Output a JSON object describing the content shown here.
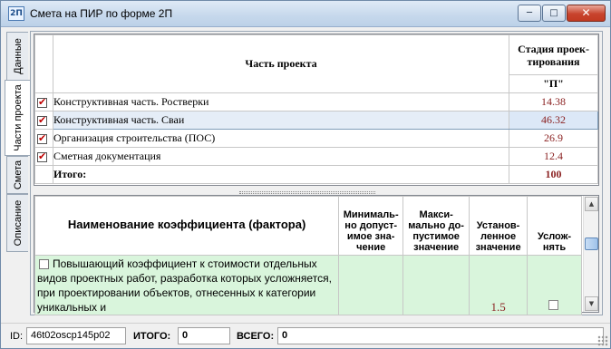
{
  "window": {
    "title": "Смета на ПИР по форме 2П",
    "app_icon_text": "2П",
    "buttons": {
      "minimize": "minimize-icon",
      "maximize": "maximize-icon",
      "close": "close-icon"
    }
  },
  "tabs": [
    {
      "label": "Данные",
      "active": false
    },
    {
      "label": "Части проекта",
      "active": true
    },
    {
      "label": "Смета",
      "active": false
    },
    {
      "label": "Описание",
      "active": false
    }
  ],
  "upper_table": {
    "col_part": "Часть проекта",
    "col_stage": "Стадия проек-тирования",
    "stage_value": "\"П\"",
    "rows": [
      {
        "label": "Конструктивная часть. Ростверки",
        "checked": true,
        "value": "14.38"
      },
      {
        "label": "Конструктивная часть. Сваи",
        "checked": true,
        "value": "46.32",
        "selected": true
      },
      {
        "label": "Организация строительства (ПОС)",
        "checked": true,
        "value": "26.9"
      },
      {
        "label": "Сметная документация",
        "checked": true,
        "value": "12.4"
      }
    ],
    "total_label": "Итого:",
    "total_value": "100"
  },
  "lower_table": {
    "headers": {
      "name": "Наименование коэффициента (фактора)",
      "min": "Минималь-но допуст-имое зна-чение",
      "max": "Макси-мально до-пустимое значение",
      "set": "Установ-ленное значение",
      "complicate": "Услож-нять"
    },
    "rows": [
      {
        "description": "Повышающий коэффициент к стоимости отдельных видов проектных работ, разработка которых усложняется, при проектировании объектов, отнесенных к категории уникальных и",
        "checked": false,
        "min": "",
        "max": "",
        "set": "1.5",
        "complicate": false
      }
    ]
  },
  "status": {
    "id_label": "ID:",
    "id_value": "46t02oscp145p02",
    "itogo_label": "ИТОГО:",
    "itogo_value": "0",
    "vsego_label": "ВСЕГО:",
    "vsego_value": "0"
  },
  "colors": {
    "value_text": "#8b2222",
    "row_highlight": "#d9f5dc",
    "selection": "#dce8f7",
    "check_mark": "#c00000"
  }
}
